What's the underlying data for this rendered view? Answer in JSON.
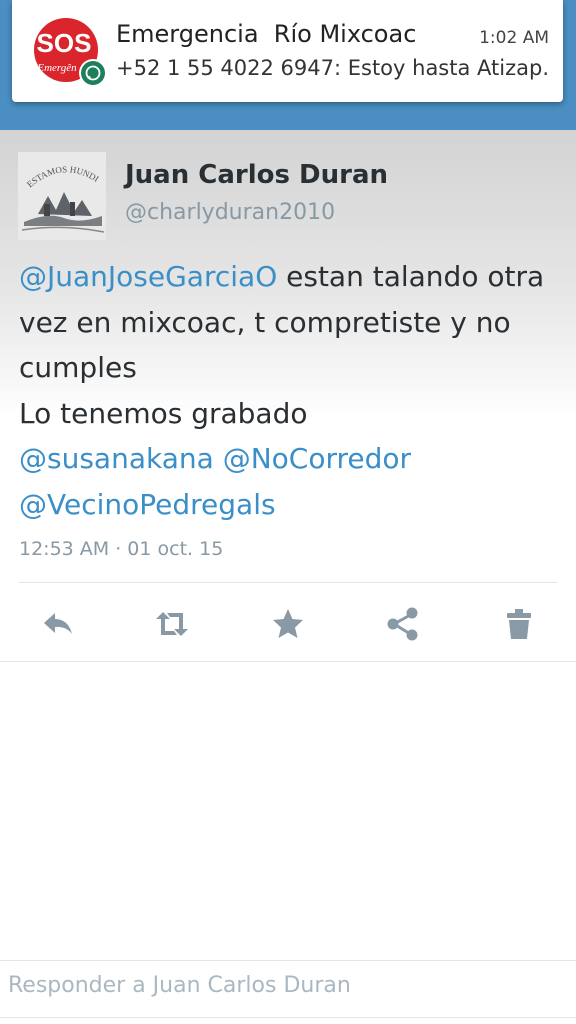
{
  "notification": {
    "app_icon": "sos-emergencia-whatsapp-icon",
    "icon_text": "SOS",
    "icon_subtext": "Emergên",
    "title": "Emergencia  Río Mixcoac",
    "time": "1:02 AM",
    "text": "+52 1 55 4022 6947: Estoy hasta Atizap.."
  },
  "tweet": {
    "avatar_text": "ESTAMOS HUNDIDOS",
    "author_name": "Juan Carlos Duran",
    "handle": "@charlyduran2010",
    "mention_1": "@JuanJoseGarciaO",
    "text_1": " estan talando otra vez en mixcoac, t compretiste y no cumples",
    "text_2": "Lo tenemos grabado",
    "mention_2": "@susanakana",
    "mention_3": "@NoCorredor",
    "mention_4": "@VecinoPedregals",
    "timestamp": "12:53 AM · 01 oct. 15"
  },
  "actions": [
    "reply-icon",
    "retweet-icon",
    "favorite-star-icon",
    "share-icon",
    "delete-trash-icon"
  ],
  "reply": {
    "placeholder": "Responder a Juan Carlos Duran"
  },
  "colors": {
    "app_bar": "#4a8ec2",
    "mention": "#3b8fc8",
    "icon_grey": "#8a99a6",
    "sos_red": "#d9252b",
    "whatsapp_green": "#1d7f5b"
  }
}
